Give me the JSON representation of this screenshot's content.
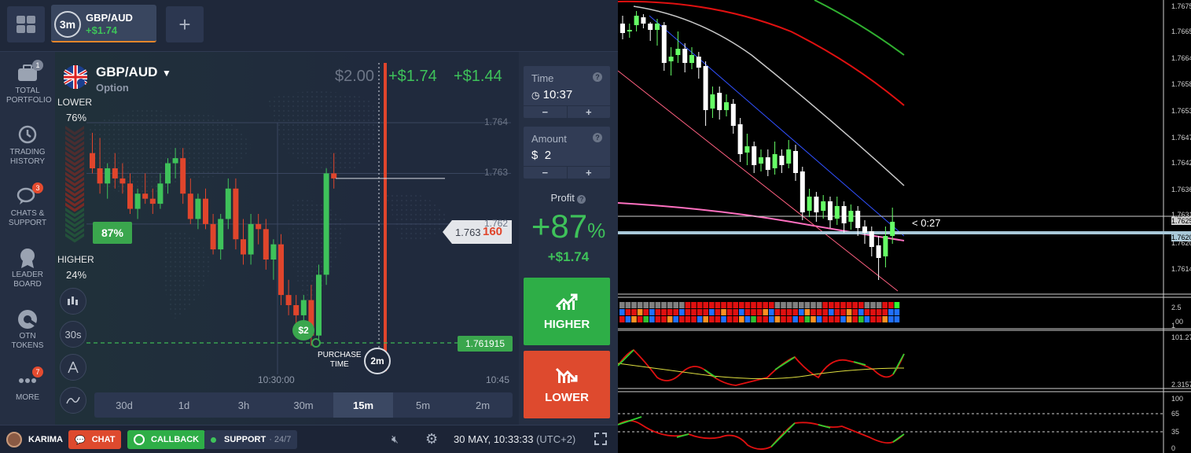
{
  "topbar": {
    "asset_tab": {
      "timer": "3m",
      "name": "GBP/AUD",
      "profit": "+$1.74"
    },
    "plus_label": "+"
  },
  "sidebar": {
    "items": [
      {
        "label": "TOTAL PORTFOLIO",
        "badge": "1",
        "icon": "briefcase-icon"
      },
      {
        "label": "TRADING HISTORY",
        "badge": "",
        "icon": "clock-history-icon"
      },
      {
        "label": "CHATS & SUPPORT",
        "badge": "3",
        "icon": "chat-bubbles-icon"
      },
      {
        "label": "LEADER BOARD",
        "badge": "",
        "icon": "medal-icon"
      },
      {
        "label": "OTN TOKENS",
        "badge": "",
        "icon": "token-icon"
      },
      {
        "label": "MORE",
        "badge": "7",
        "icon": "more-dots-icon"
      }
    ]
  },
  "chart": {
    "asset_name": "GBP/AUD",
    "asset_type": "Option",
    "lower_label": "LOWER",
    "lower_pct": "76%",
    "higher_label": "HIGHER",
    "higher_pct": "24%",
    "position_pct": "87%",
    "ghost_amount": "$2.00",
    "profit_a": "+$1.74",
    "profit_b": "+$1.44",
    "price_ticks": [
      "1.764",
      "1.763",
      "1.762"
    ],
    "current_price_main": "1.763",
    "current_price_tail": "160",
    "entry_price": "1.761915",
    "deal_marker": "$2",
    "purchase_label_1": "PURCHASE",
    "purchase_label_2": "TIME",
    "expiry_timer": "2m",
    "time_ticks": [
      "10:30:00",
      "10:45"
    ],
    "timeframes": [
      "30d",
      "1d",
      "3h",
      "30m",
      "15m",
      "5m",
      "2m"
    ],
    "active_timeframe": "15m",
    "candle_interval_tool": "30s",
    "candles": [
      {
        "o": 1.7634,
        "h": 1.7638,
        "l": 1.763,
        "c": 1.7631
      },
      {
        "o": 1.7631,
        "h": 1.7637,
        "l": 1.7626,
        "c": 1.7628
      },
      {
        "o": 1.7628,
        "h": 1.7632,
        "l": 1.7625,
        "c": 1.7631
      },
      {
        "o": 1.7631,
        "h": 1.7634,
        "l": 1.7627,
        "c": 1.7629
      },
      {
        "o": 1.7629,
        "h": 1.7632,
        "l": 1.7626,
        "c": 1.7628
      },
      {
        "o": 1.7628,
        "h": 1.763,
        "l": 1.7622,
        "c": 1.7623
      },
      {
        "o": 1.7623,
        "h": 1.7627,
        "l": 1.7621,
        "c": 1.7626
      },
      {
        "o": 1.7626,
        "h": 1.763,
        "l": 1.7624,
        "c": 1.7625
      },
      {
        "o": 1.7625,
        "h": 1.7627,
        "l": 1.7622,
        "c": 1.7624
      },
      {
        "o": 1.7624,
        "h": 1.763,
        "l": 1.7623,
        "c": 1.7628
      },
      {
        "o": 1.7628,
        "h": 1.7633,
        "l": 1.7626,
        "c": 1.7632
      },
      {
        "o": 1.7632,
        "h": 1.7635,
        "l": 1.7629,
        "c": 1.7633
      },
      {
        "o": 1.7633,
        "h": 1.7635,
        "l": 1.7624,
        "c": 1.7626
      },
      {
        "o": 1.7626,
        "h": 1.7629,
        "l": 1.762,
        "c": 1.7621
      },
      {
        "o": 1.7621,
        "h": 1.7626,
        "l": 1.7619,
        "c": 1.7625
      },
      {
        "o": 1.7625,
        "h": 1.7627,
        "l": 1.7619,
        "c": 1.762
      },
      {
        "o": 1.762,
        "h": 1.7622,
        "l": 1.7614,
        "c": 1.7615
      },
      {
        "o": 1.7615,
        "h": 1.7622,
        "l": 1.7613,
        "c": 1.7621
      },
      {
        "o": 1.7621,
        "h": 1.7629,
        "l": 1.7619,
        "c": 1.7627
      },
      {
        "o": 1.7627,
        "h": 1.7629,
        "l": 1.7615,
        "c": 1.7617
      },
      {
        "o": 1.7617,
        "h": 1.7621,
        "l": 1.7612,
        "c": 1.7614
      },
      {
        "o": 1.7614,
        "h": 1.7622,
        "l": 1.7612,
        "c": 1.762
      },
      {
        "o": 1.762,
        "h": 1.7622,
        "l": 1.7616,
        "c": 1.7619
      },
      {
        "o": 1.7619,
        "h": 1.7621,
        "l": 1.7611,
        "c": 1.7613
      },
      {
        "o": 1.7613,
        "h": 1.7617,
        "l": 1.7609,
        "c": 1.7616
      },
      {
        "o": 1.7616,
        "h": 1.7618,
        "l": 1.7604,
        "c": 1.7606
      },
      {
        "o": 1.7606,
        "h": 1.7609,
        "l": 1.7602,
        "c": 1.7604
      },
      {
        "o": 1.7604,
        "h": 1.7606,
        "l": 1.76,
        "c": 1.7602
      },
      {
        "o": 1.7602,
        "h": 1.7606,
        "l": 1.7599,
        "c": 1.7605
      },
      {
        "o": 1.7605,
        "h": 1.7608,
        "l": 1.7596,
        "c": 1.7598
      },
      {
        "o": 1.7598,
        "h": 1.7612,
        "l": 1.7597,
        "c": 1.761
      },
      {
        "o": 1.761,
        "h": 1.7631,
        "l": 1.7608,
        "c": 1.763
      },
      {
        "o": 1.763,
        "h": 1.7634,
        "l": 1.7627,
        "c": 1.7629
      }
    ]
  },
  "trade_panel": {
    "time_label": "Time",
    "time_value": "10:37",
    "amount_label": "Amount",
    "amount_currency": "$",
    "amount_value": "2",
    "help_glyph": "?",
    "minus_glyph": "−",
    "plus_glyph": "+",
    "profit_label": "Profit",
    "profit_pct": "+87",
    "profit_pct_sign": "%",
    "profit_amount": "+$1.74",
    "higher_btn": "HIGHER",
    "lower_btn": "LOWER",
    "higher_color": "#2eae47",
    "lower_color": "#de4a2e"
  },
  "bottombar": {
    "user": "KARIMA",
    "chat": "CHAT",
    "callback": "CALLBACK",
    "support": "SUPPORT",
    "support_hours": "· 24/7",
    "datetime": "30 MAY, 10:33:33",
    "timezone": "(UTC+2)"
  },
  "mt4": {
    "price_labels": [
      "1.7675",
      "1.7665",
      "1.7664",
      "1.7658",
      "1.7653",
      "1.7647",
      "1.7642",
      "1.7636",
      "1.7631",
      "1.7625",
      "1.7620",
      "1.7620",
      "1.7614"
    ],
    "countdown": "< 0:27",
    "ind1_labels": [
      "2.5",
      "00",
      "1"
    ],
    "ind2_labels": [
      "101.27",
      "2.3157"
    ],
    "ind3_labels": [
      "100",
      "65",
      "35",
      "0"
    ],
    "bull_color": "#66ff66",
    "bear_color": "#ffffff"
  }
}
